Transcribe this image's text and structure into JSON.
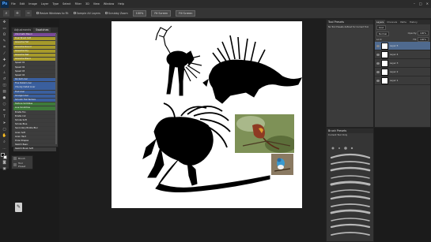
{
  "app": {
    "logo": "Ps",
    "menu": [
      "File",
      "Edit",
      "Image",
      "Layer",
      "Type",
      "Select",
      "Filter",
      "3D",
      "View",
      "Window",
      "Help"
    ],
    "window_controls": [
      "–",
      "□",
      "✕"
    ]
  },
  "options_bar": {
    "sample_all_layers": "Sample All Layers",
    "scrubby_zoom": "Scrubby Zoom",
    "actual_pixels": "100%",
    "fit_screen": "Fit Screen",
    "fill_screen": "Fill Screen",
    "resize_windows": "Resize Windows to Fit"
  },
  "presets_panel": {
    "tabs": [
      "Adjustments",
      "Swatches",
      "Tool Presets"
    ],
    "items": [
      {
        "label": "Chromatic Blend",
        "color": "#7a4a9a"
      },
      {
        "label": "Dual Brush Soft",
        "color": "#a69a2a"
      },
      {
        "label": "Gouache Flat",
        "color": "#a69a2a"
      },
      {
        "label": "Gouache Round",
        "color": "#a69a2a"
      },
      {
        "label": "Gouache Dry",
        "color": "#a69a2a"
      },
      {
        "label": "Gouache Wet",
        "color": "#a69a2a"
      },
      {
        "label": "Gouache Blend",
        "color": "#a69a2a"
      },
      {
        "label": "Speed 01",
        "color": "#3d3d3d"
      },
      {
        "label": "Speed 02",
        "color": "#3d3d3d"
      },
      {
        "label": "Speed 03",
        "color": "#3d3d3d"
      },
      {
        "label": "Speed 04",
        "color": "#3d3d3d"
      },
      {
        "label": "Rocket Liner",
        "color": "#3a5f9e"
      },
      {
        "label": "Fine Detail Liner",
        "color": "#3a5f9e"
      },
      {
        "label": "Chunky Detail Liner",
        "color": "#3a5f9e"
      },
      {
        "label": "Flat Liner",
        "color": "#3a5f9e"
      },
      {
        "label": "Grunge Liner",
        "color": "#3a5f9e"
      },
      {
        "label": "Smooth Flat Texture",
        "color": "#3a5f9e"
      },
      {
        "label": "Texture Scribbles",
        "color": "#3f7a3a"
      },
      {
        "label": "Line Scratches",
        "color": "#3f7a3a"
      },
      {
        "label": "Bristle Fan",
        "color": "#3d3d3d"
      },
      {
        "label": "Bristle Cut",
        "color": "#3d3d3d"
      },
      {
        "label": "Smoke Soft",
        "color": "#3d3d3d"
      },
      {
        "label": "Smoke Blue",
        "color": "#3d3d3d"
      },
      {
        "label": "Secondary Bristle Blur",
        "color": "#3d3d3d"
      },
      {
        "label": "Grain Soft",
        "color": "#3d3d3d"
      },
      {
        "label": "Grain Hard",
        "color": "#3d3d3d"
      },
      {
        "label": "Draw Shapes",
        "color": "#3d3d3d"
      },
      {
        "label": "Sketch Basic",
        "color": "#3d3d3d"
      },
      {
        "label": "Sketch Brush Soft",
        "color": "#3d3d3d"
      }
    ]
  },
  "mini_panel": {
    "rows": [
      "Brush",
      "Tool Preset"
    ]
  },
  "tool_preset_panel": {
    "title": "Tool Presets",
    "subtitle": "No Tool Presets defined for Current Tool"
  },
  "layers_panel": {
    "tabs": [
      "Layers",
      "Channels",
      "Paths",
      "History"
    ],
    "kind": "Kind",
    "blend_mode": "Normal",
    "opacity_label": "Opacity:",
    "opacity_value": "100%",
    "lock_label": "Lock:",
    "fill_label": "Fill:",
    "fill_value": "100%",
    "layers": [
      {
        "name": "Layer 5",
        "selected": true
      },
      {
        "name": "Layer 4",
        "selected": false
      },
      {
        "name": "Layer 3",
        "selected": false
      },
      {
        "name": "Layer 2",
        "selected": false
      },
      {
        "name": "Layer 1",
        "selected": false
      }
    ]
  },
  "brush_panel": {
    "title": "Brush Presets",
    "subtitle": "Current Tool Only",
    "size_label": "Size:"
  }
}
